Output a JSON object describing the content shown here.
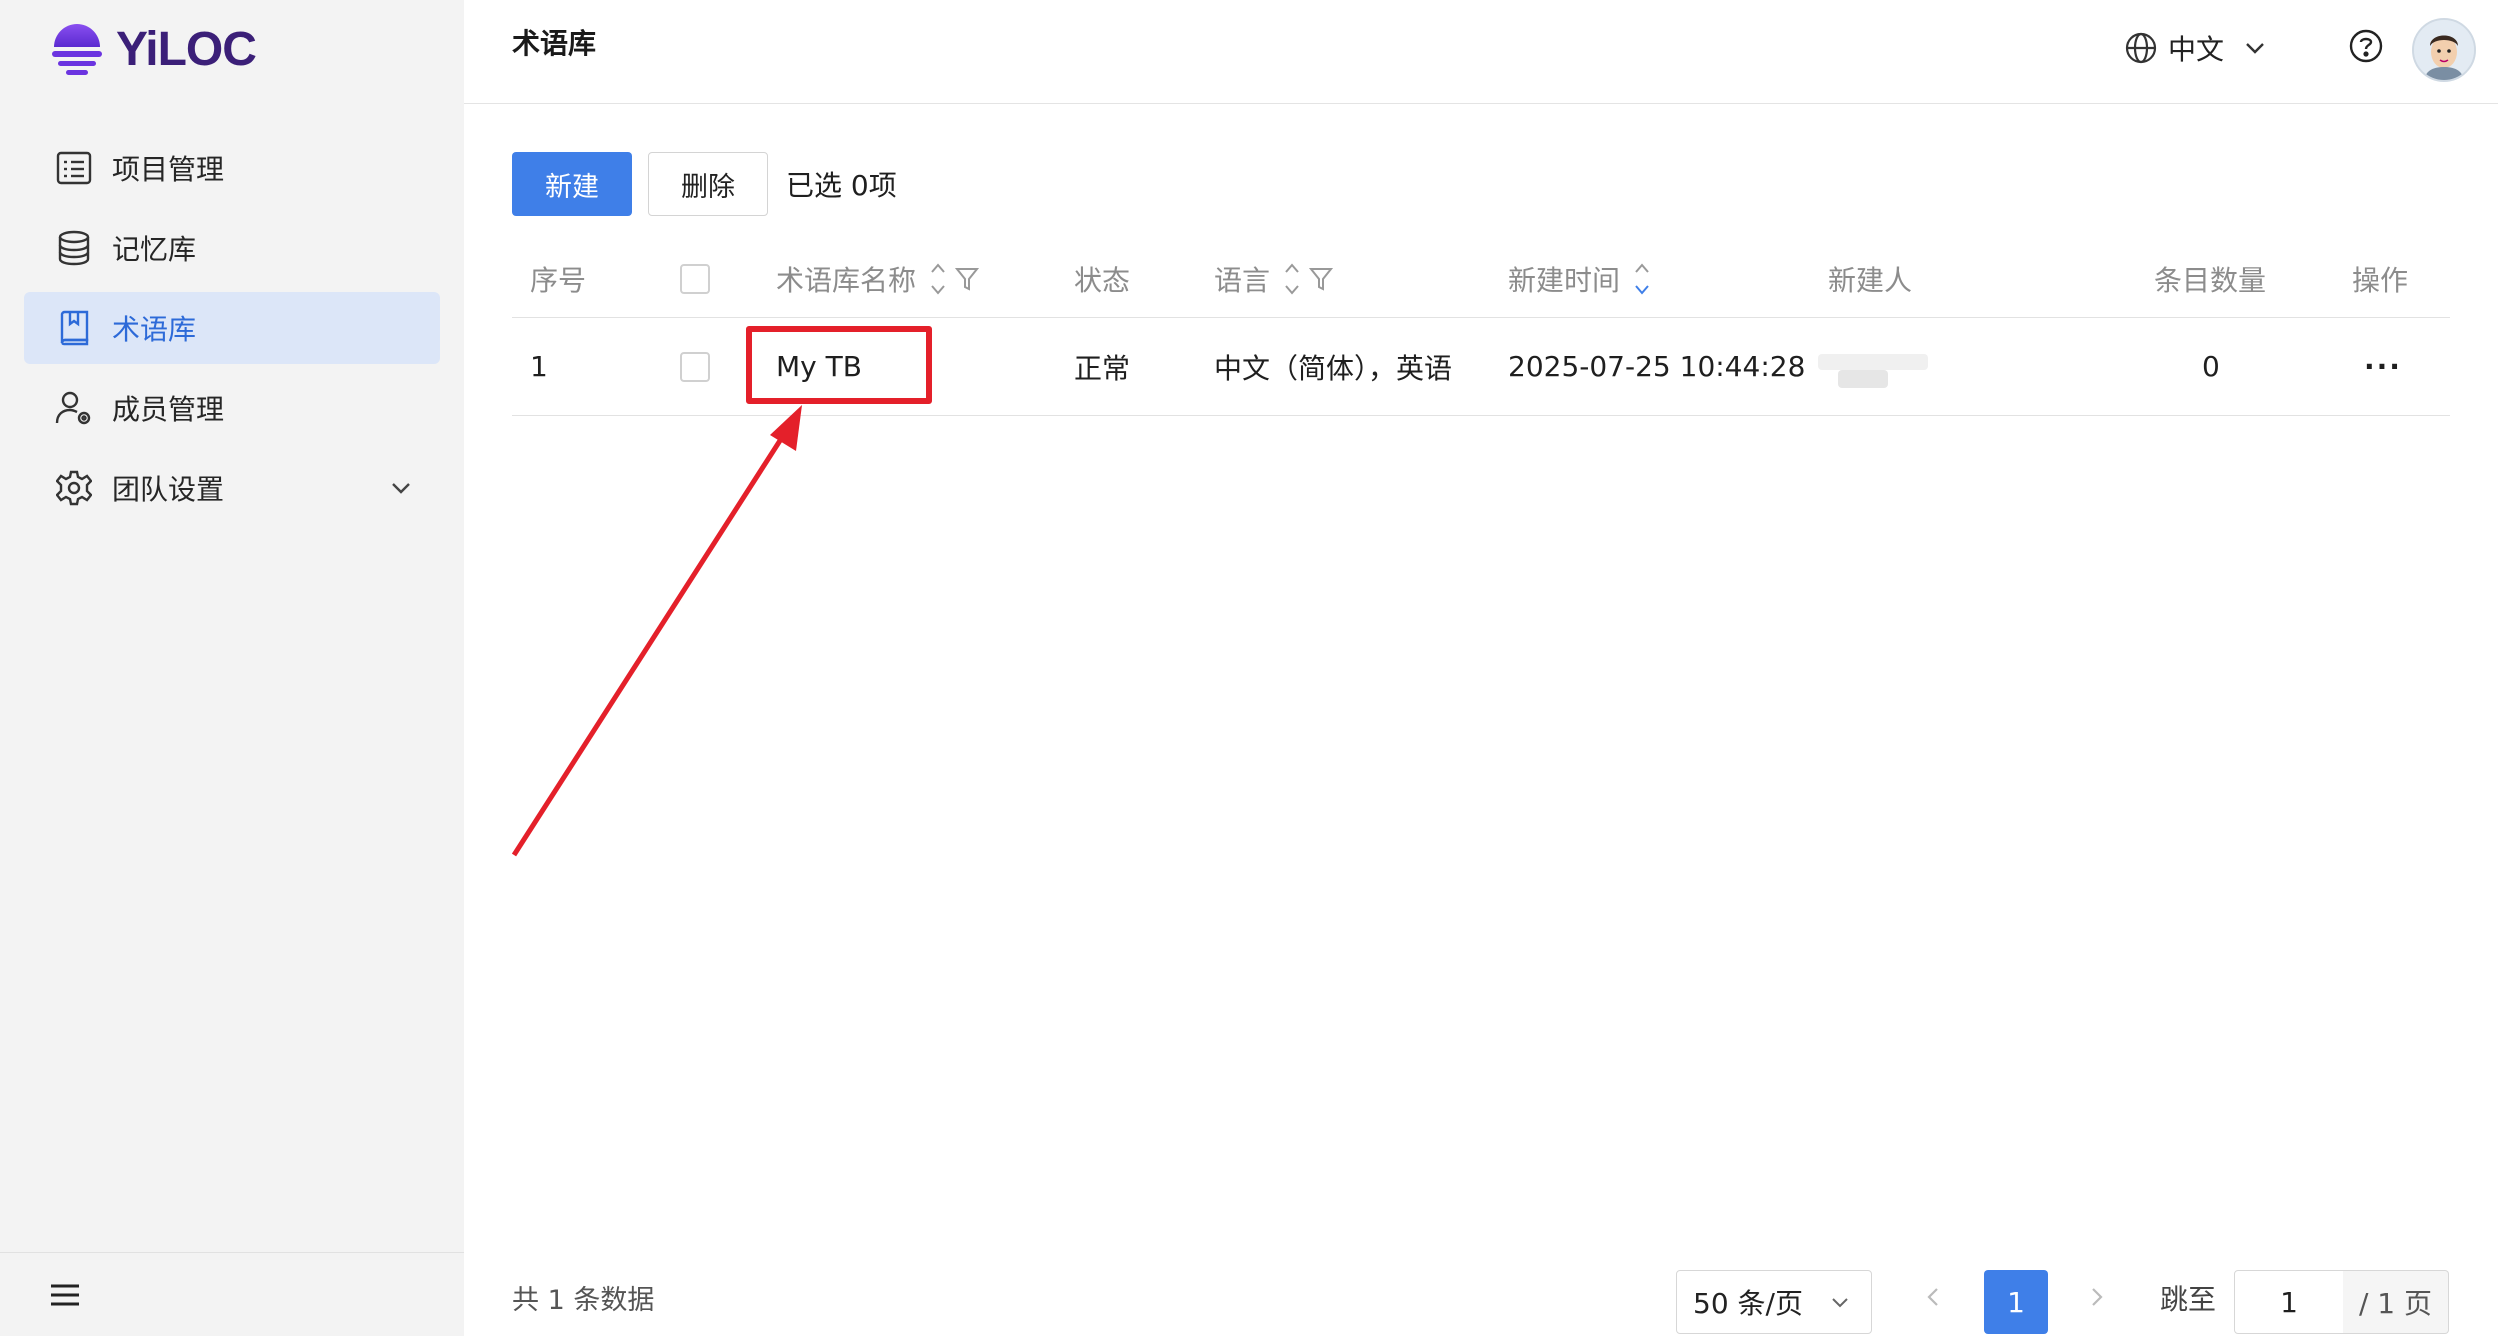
{
  "app": {
    "logo_text": "YiLOC"
  },
  "sidebar": {
    "items": [
      {
        "label": "项目管理",
        "icon": "list-icon",
        "active": false
      },
      {
        "label": "记忆库",
        "icon": "database-icon",
        "active": false
      },
      {
        "label": "术语库",
        "icon": "book-icon",
        "active": true
      },
      {
        "label": "成员管理",
        "icon": "user-settings-icon",
        "active": false
      },
      {
        "label": "团队设置",
        "icon": "gear-icon",
        "active": false,
        "expandable": true
      }
    ]
  },
  "header": {
    "title": "术语库",
    "language": "中文"
  },
  "toolbar": {
    "new_label": "新建",
    "delete_label": "删除",
    "selected_text": "已选 0项"
  },
  "table": {
    "columns": [
      "序号",
      "术语库名称",
      "状态",
      "语言",
      "新建时间",
      "新建人",
      "条目数量",
      "操作"
    ],
    "rows": [
      {
        "index": "1",
        "name": "My TB",
        "status": "正常",
        "language": "中文（简体），英语",
        "created_at": "2025-07-25 10:44:28",
        "creator": "",
        "count": "0",
        "actions": "···"
      }
    ]
  },
  "pagination": {
    "total_text": "共 1 条数据",
    "page_size": "50 条/页",
    "current_page": "1",
    "jump_label": "跳至",
    "jump_value": "1",
    "total_pages": "/ 1 页"
  },
  "colors": {
    "primary": "#3f7fe8",
    "link": "#2f67d8",
    "annotation_red": "#e4202a",
    "brand": "#3b1f78"
  }
}
